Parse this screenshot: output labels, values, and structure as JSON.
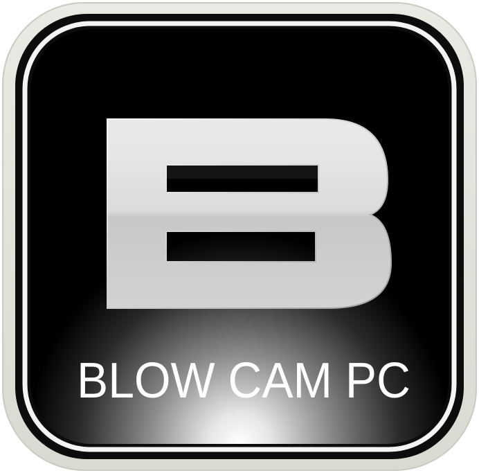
{
  "icon": {
    "letter": "B",
    "label": "BLOW CAM PC",
    "colors": {
      "outer_frame": "#e2e3dc",
      "inner_ring": "#111111",
      "highlight_ring": "#f4f4f4",
      "background_top": "#000000",
      "background_glow": "#ffffff",
      "letter_fill": "#d8d8d8",
      "label_color": "#ffffff"
    }
  }
}
